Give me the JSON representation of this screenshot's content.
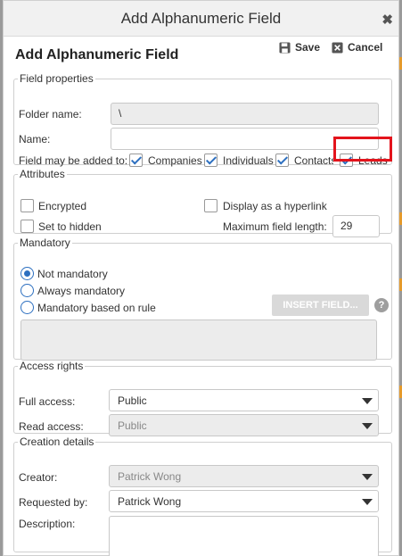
{
  "dialog": {
    "window_title": "Add Alphanumeric Field",
    "header_title": "Add Alphanumeric Field",
    "save_label": "Save",
    "cancel_label": "Cancel"
  },
  "field_properties": {
    "legend": "Field properties",
    "folder_name_label": "Folder name:",
    "folder_name_value": "\\",
    "name_label": "Name:",
    "name_value": "",
    "added_to_label": "Field may be added to:",
    "options": [
      {
        "label": "Companies",
        "checked": true
      },
      {
        "label": "Individuals",
        "checked": true
      },
      {
        "label": "Contacts",
        "checked": true
      },
      {
        "label": "Leads",
        "checked": true
      }
    ]
  },
  "attributes": {
    "legend": "Attributes",
    "encrypted_label": "Encrypted",
    "hidden_label": "Set to hidden",
    "hyperlink_label": "Display as a hyperlink",
    "max_length_label": "Maximum field length:",
    "max_length_value": "29"
  },
  "mandatory": {
    "legend": "Mandatory",
    "options": [
      "Not mandatory",
      "Always mandatory",
      "Mandatory based on rule"
    ],
    "selected": "Not mandatory",
    "insert_field_label": "INSERT FIELD...",
    "help_label": "?"
  },
  "access_rights": {
    "legend": "Access rights",
    "full_access_label": "Full access:",
    "full_access_value": "Public",
    "read_access_label": "Read access:",
    "read_access_value": "Public"
  },
  "creation_details": {
    "legend": "Creation details",
    "creator_label": "Creator:",
    "creator_value": "Patrick Wong",
    "requested_by_label": "Requested by:",
    "requested_by_value": "Patrick Wong",
    "description_label": "Description:"
  },
  "colors": {
    "accent": "#2c6fc0",
    "highlight": "#e3141c"
  }
}
